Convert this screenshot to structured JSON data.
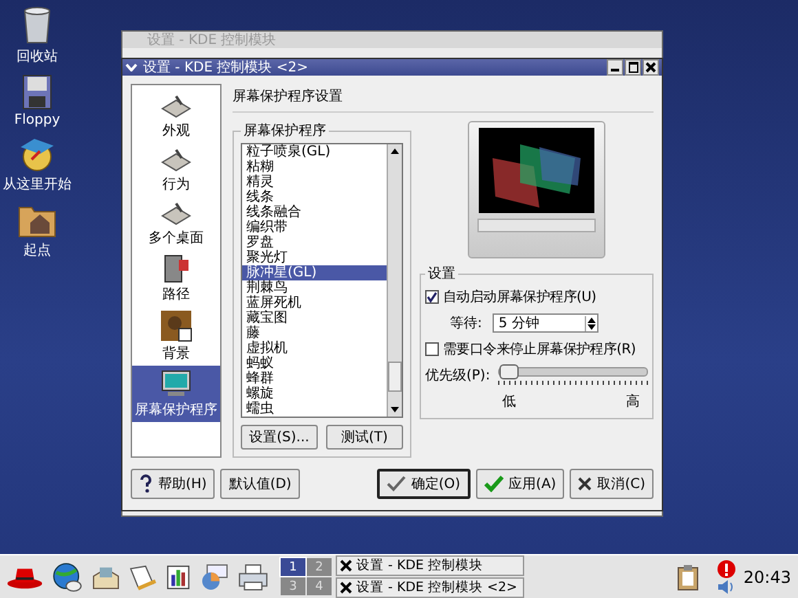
{
  "desktop_icons": [
    {
      "label": "回收站",
      "kind": "trash"
    },
    {
      "label": "Floppy",
      "kind": "floppy"
    },
    {
      "label": "从这里开始",
      "kind": "globe"
    },
    {
      "label": "起点",
      "kind": "home"
    }
  ],
  "back_window": {
    "title": "设置 - KDE 控制模块"
  },
  "window": {
    "title": "设置 - KDE 控制模块 <2>",
    "sidebar": [
      {
        "label": "外观",
        "kind": "tools",
        "selected": false
      },
      {
        "label": "行为",
        "kind": "tools",
        "selected": false
      },
      {
        "label": "多个桌面",
        "kind": "tools",
        "selected": false
      },
      {
        "label": "路径",
        "kind": "cabinet",
        "selected": false
      },
      {
        "label": "背景",
        "kind": "picture",
        "selected": false
      },
      {
        "label": "屏幕保护程序",
        "kind": "monitor",
        "selected": true
      }
    ],
    "header": "屏幕保护程序设置",
    "saver_group": {
      "title": "屏幕保护程序",
      "items": [
        {
          "label": "粒子喷泉(GL)",
          "selected": false
        },
        {
          "label": "粘糊",
          "selected": false
        },
        {
          "label": "精灵",
          "selected": false
        },
        {
          "label": "线条",
          "selected": false
        },
        {
          "label": "线条融合",
          "selected": false
        },
        {
          "label": "编织带",
          "selected": false
        },
        {
          "label": "罗盘",
          "selected": false
        },
        {
          "label": "聚光灯",
          "selected": false
        },
        {
          "label": "脉冲星(GL)",
          "selected": true
        },
        {
          "label": "荆棘鸟",
          "selected": false
        },
        {
          "label": "蓝屏死机",
          "selected": false
        },
        {
          "label": "藏宝图",
          "selected": false
        },
        {
          "label": "藤",
          "selected": false
        },
        {
          "label": "虚拟机",
          "selected": false
        },
        {
          "label": "蚂蚁",
          "selected": false
        },
        {
          "label": "蜂群",
          "selected": false
        },
        {
          "label": "螺旋",
          "selected": false
        },
        {
          "label": "蠕虫",
          "selected": false
        }
      ],
      "buttons": [
        "设置(S)...",
        "测试(T)"
      ]
    },
    "settings_group": {
      "title": "设置",
      "auto_start": {
        "label": "自动启动屏幕保护程序(U)",
        "checked": true
      },
      "wait": {
        "label": "等待:",
        "value": "5 分钟"
      },
      "require_password": {
        "label": "需要口令来停止屏幕保护程序(R)",
        "checked": false
      },
      "priority": {
        "label": "优先级(P):",
        "level": 0,
        "low": "低",
        "high": "高"
      }
    },
    "buttons": [
      {
        "label": "帮助(H)",
        "kind": "help",
        "selected": false
      },
      {
        "label": "默认值(D)",
        "kind": "plain",
        "selected": false
      },
      {
        "label": "确定(O)",
        "kind": "ok",
        "selected": true
      },
      {
        "label": "应用(A)",
        "kind": "apply",
        "selected": false
      },
      {
        "label": "取消(C)",
        "kind": "cancel",
        "selected": false
      }
    ]
  },
  "taskbar": {
    "pager": [
      {
        "label": "1",
        "selected": true
      },
      {
        "label": "2",
        "selected": false
      },
      {
        "label": "3",
        "selected": false
      },
      {
        "label": "4",
        "selected": false
      }
    ],
    "tasks": [
      {
        "label": "设置 - KDE 控制模块"
      },
      {
        "label": "设置 - KDE 控制模块 <2>"
      }
    ],
    "clock": "20:43"
  }
}
